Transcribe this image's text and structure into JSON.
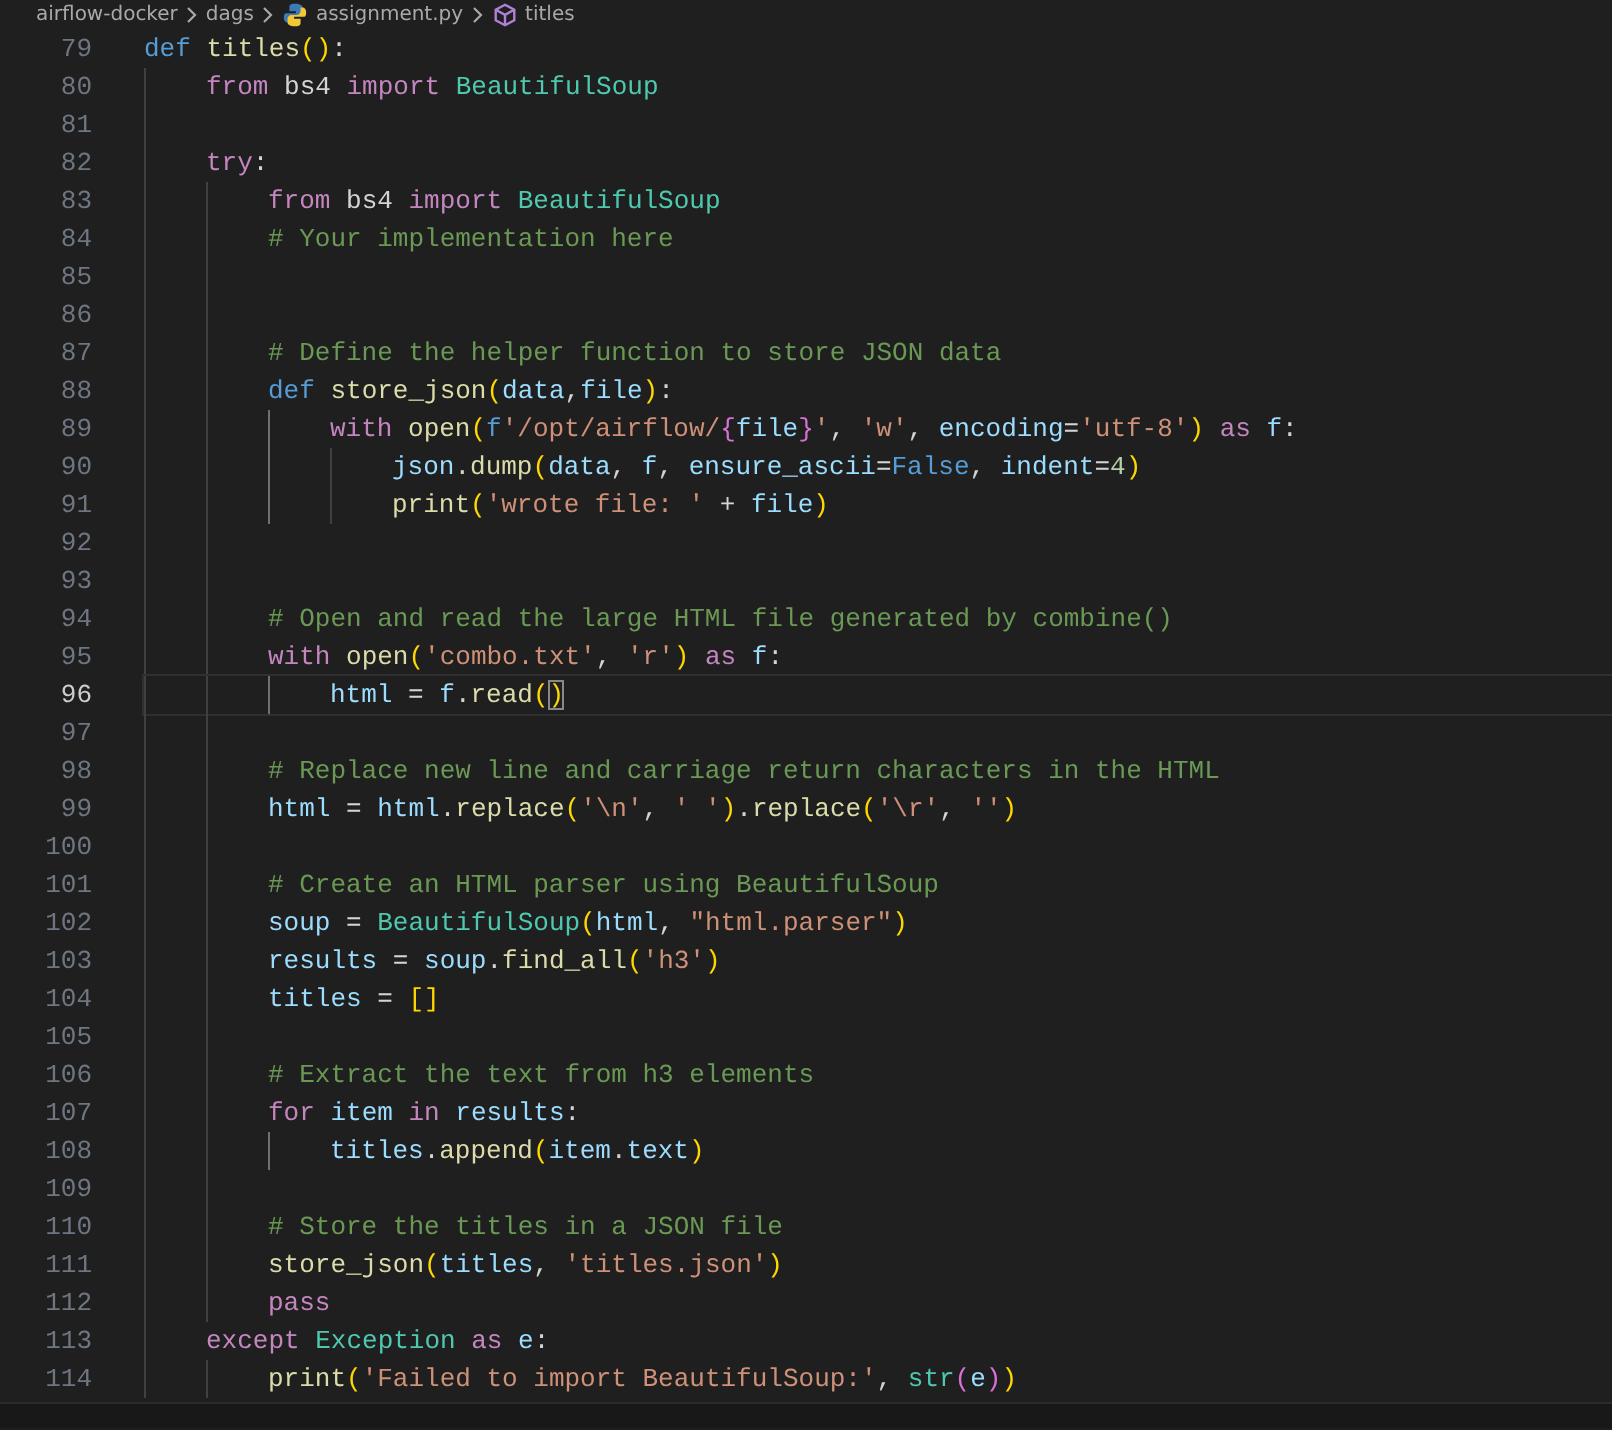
{
  "breadcrumb": [
    {
      "kind": "folder",
      "text": "airflow-docker"
    },
    {
      "kind": "folder",
      "text": "dags"
    },
    {
      "kind": "python-file",
      "text": "assignment.py"
    },
    {
      "kind": "function",
      "text": "titles"
    }
  ],
  "lines": [
    {
      "number": "79",
      "current": false,
      "tokens": [
        {
          "kind": "kw",
          "text": "def "
        },
        {
          "kind": "fn",
          "text": "titles"
        },
        {
          "kind": "b1",
          "text": "()"
        },
        {
          "kind": "op",
          "text": ":"
        }
      ],
      "children": [
        {
          "number": "80",
          "current": false,
          "tokens": [
            {
              "kind": "ctl",
              "text": "from "
            },
            {
              "kind": "mod",
              "text": "bs4 "
            },
            {
              "kind": "ctl",
              "text": "import "
            },
            {
              "kind": "cls",
              "text": "BeautifulSoup"
            }
          ]
        },
        {
          "number": "81",
          "current": false
        },
        {
          "number": "82",
          "current": false,
          "tokens": [
            {
              "kind": "ctl",
              "text": "try"
            },
            {
              "kind": "op",
              "text": ":"
            }
          ],
          "children": [
            {
              "number": "83",
              "current": false,
              "tokens": [
                {
                  "kind": "ctl",
                  "text": "from "
                },
                {
                  "kind": "mod",
                  "text": "bs4 "
                },
                {
                  "kind": "ctl",
                  "text": "import "
                },
                {
                  "kind": "cls",
                  "text": "BeautifulSoup"
                }
              ]
            },
            {
              "number": "84",
              "current": false,
              "tokens": [
                {
                  "kind": "com",
                  "text": "# Your implementation here"
                }
              ]
            },
            {
              "number": "85",
              "current": false
            },
            {
              "number": "86",
              "current": false
            },
            {
              "number": "87",
              "current": false,
              "tokens": [
                {
                  "kind": "com",
                  "text": "# Define the helper function to store JSON data"
                }
              ]
            },
            {
              "number": "88",
              "current": false,
              "tokens": [
                {
                  "kind": "kw",
                  "text": "def "
                },
                {
                  "kind": "fn",
                  "text": "store_json"
                },
                {
                  "kind": "b1",
                  "text": "("
                },
                {
                  "kind": "var",
                  "text": "data"
                },
                {
                  "kind": "op",
                  "text": ","
                },
                {
                  "kind": "var",
                  "text": "file"
                },
                {
                  "kind": "b1",
                  "text": ")"
                },
                {
                  "kind": "op",
                  "text": ":"
                }
              ],
              "children": [
                {
                  "number": "89",
                  "current": false,
                  "tokens": [
                    {
                      "kind": "ctl",
                      "text": "with "
                    },
                    {
                      "kind": "fn",
                      "text": "open"
                    },
                    {
                      "kind": "b1",
                      "text": "("
                    },
                    {
                      "kind": "kw",
                      "text": "f"
                    },
                    {
                      "kind": "str",
                      "text": "'/opt/airflow/"
                    },
                    {
                      "kind": "b2",
                      "text": "{"
                    },
                    {
                      "kind": "var",
                      "text": "file"
                    },
                    {
                      "kind": "b2",
                      "text": "}"
                    },
                    {
                      "kind": "str",
                      "text": "'"
                    },
                    {
                      "kind": "op",
                      "text": ", "
                    },
                    {
                      "kind": "str",
                      "text": "'w'"
                    },
                    {
                      "kind": "op",
                      "text": ", "
                    },
                    {
                      "kind": "var",
                      "text": "encoding"
                    },
                    {
                      "kind": "op",
                      "text": "="
                    },
                    {
                      "kind": "str",
                      "text": "'utf-8'"
                    },
                    {
                      "kind": "b1",
                      "text": ")"
                    },
                    {
                      "kind": "ctl",
                      "text": " as "
                    },
                    {
                      "kind": "var",
                      "text": "f"
                    },
                    {
                      "kind": "op",
                      "text": ":"
                    }
                  ],
                  "children": [
                    {
                      "number": "90",
                      "current": false,
                      "tokens": [
                        {
                          "kind": "var",
                          "text": "json"
                        },
                        {
                          "kind": "op",
                          "text": "."
                        },
                        {
                          "kind": "fn",
                          "text": "dump"
                        },
                        {
                          "kind": "b1",
                          "text": "("
                        },
                        {
                          "kind": "var",
                          "text": "data"
                        },
                        {
                          "kind": "op",
                          "text": ", "
                        },
                        {
                          "kind": "var",
                          "text": "f"
                        },
                        {
                          "kind": "op",
                          "text": ", "
                        },
                        {
                          "kind": "var",
                          "text": "ensure_ascii"
                        },
                        {
                          "kind": "op",
                          "text": "="
                        },
                        {
                          "kind": "kw",
                          "text": "False"
                        },
                        {
                          "kind": "op",
                          "text": ", "
                        },
                        {
                          "kind": "var",
                          "text": "indent"
                        },
                        {
                          "kind": "op",
                          "text": "="
                        },
                        {
                          "kind": "num",
                          "text": "4"
                        },
                        {
                          "kind": "b1",
                          "text": ")"
                        }
                      ]
                    },
                    {
                      "number": "91",
                      "current": false,
                      "tokens": [
                        {
                          "kind": "fn",
                          "text": "print"
                        },
                        {
                          "kind": "b1",
                          "text": "("
                        },
                        {
                          "kind": "str",
                          "text": "'wrote file: '"
                        },
                        {
                          "kind": "op",
                          "text": " + "
                        },
                        {
                          "kind": "var",
                          "text": "file"
                        },
                        {
                          "kind": "b1",
                          "text": ")"
                        }
                      ]
                    }
                  ]
                }
              ]
            },
            {
              "number": "92",
              "current": false
            },
            {
              "number": "93",
              "current": false
            },
            {
              "number": "94",
              "current": false,
              "tokens": [
                {
                  "kind": "com",
                  "text": "# Open and read the large HTML file generated by combine()"
                }
              ]
            },
            {
              "number": "95",
              "current": false,
              "tokens": [
                {
                  "kind": "ctl",
                  "text": "with "
                },
                {
                  "kind": "fn",
                  "text": "open"
                },
                {
                  "kind": "b1",
                  "text": "("
                },
                {
                  "kind": "str",
                  "text": "'combo.txt'"
                },
                {
                  "kind": "op",
                  "text": ", "
                },
                {
                  "kind": "str",
                  "text": "'r'"
                },
                {
                  "kind": "b1",
                  "text": ")"
                },
                {
                  "kind": "ctl",
                  "text": " as "
                },
                {
                  "kind": "var",
                  "text": "f"
                },
                {
                  "kind": "op",
                  "text": ":"
                }
              ],
              "children": [
                {
                  "number": "96",
                  "current": true,
                  "tokens": [
                    {
                      "kind": "var",
                      "text": "html"
                    },
                    {
                      "kind": "op",
                      "text": " = "
                    },
                    {
                      "kind": "var",
                      "text": "f"
                    },
                    {
                      "kind": "op",
                      "text": "."
                    },
                    {
                      "kind": "fn",
                      "text": "read"
                    },
                    {
                      "kind": "b1",
                      "text": "("
                    },
                    {
                      "kind": "match",
                      "text": ")"
                    }
                  ]
                }
              ]
            },
            {
              "number": "97",
              "current": false
            },
            {
              "number": "98",
              "current": false,
              "tokens": [
                {
                  "kind": "com",
                  "text": "# Replace new line and carriage return characters in the HTML"
                }
              ]
            },
            {
              "number": "99",
              "current": false,
              "tokens": [
                {
                  "kind": "var",
                  "text": "html"
                },
                {
                  "kind": "op",
                  "text": " = "
                },
                {
                  "kind": "var",
                  "text": "html"
                },
                {
                  "kind": "op",
                  "text": "."
                },
                {
                  "kind": "fn",
                  "text": "replace"
                },
                {
                  "kind": "b1",
                  "text": "("
                },
                {
                  "kind": "str",
                  "text": "'\\n'"
                },
                {
                  "kind": "op",
                  "text": ", "
                },
                {
                  "kind": "str",
                  "text": "' '"
                },
                {
                  "kind": "b1",
                  "text": ")"
                },
                {
                  "kind": "op",
                  "text": "."
                },
                {
                  "kind": "fn",
                  "text": "replace"
                },
                {
                  "kind": "b1",
                  "text": "("
                },
                {
                  "kind": "str",
                  "text": "'\\r'"
                },
                {
                  "kind": "op",
                  "text": ", "
                },
                {
                  "kind": "str",
                  "text": "''"
                },
                {
                  "kind": "b1",
                  "text": ")"
                }
              ]
            },
            {
              "number": "100",
              "current": false
            },
            {
              "number": "101",
              "current": false,
              "tokens": [
                {
                  "kind": "com",
                  "text": "# Create an HTML parser using BeautifulSoup"
                }
              ]
            },
            {
              "number": "102",
              "current": false,
              "tokens": [
                {
                  "kind": "var",
                  "text": "soup"
                },
                {
                  "kind": "op",
                  "text": " = "
                },
                {
                  "kind": "cls",
                  "text": "BeautifulSoup"
                },
                {
                  "kind": "b1",
                  "text": "("
                },
                {
                  "kind": "var",
                  "text": "html"
                },
                {
                  "kind": "op",
                  "text": ", "
                },
                {
                  "kind": "str",
                  "text": "\"html.parser\""
                },
                {
                  "kind": "b1",
                  "text": ")"
                }
              ]
            },
            {
              "number": "103",
              "current": false,
              "tokens": [
                {
                  "kind": "var",
                  "text": "results"
                },
                {
                  "kind": "op",
                  "text": " = "
                },
                {
                  "kind": "var",
                  "text": "soup"
                },
                {
                  "kind": "op",
                  "text": "."
                },
                {
                  "kind": "fn",
                  "text": "find_all"
                },
                {
                  "kind": "b1",
                  "text": "("
                },
                {
                  "kind": "str",
                  "text": "'h3'"
                },
                {
                  "kind": "b1",
                  "text": ")"
                }
              ]
            },
            {
              "number": "104",
              "current": false,
              "tokens": [
                {
                  "kind": "var",
                  "text": "titles"
                },
                {
                  "kind": "op",
                  "text": " = "
                },
                {
                  "kind": "b1",
                  "text": "[]"
                }
              ]
            },
            {
              "number": "105",
              "current": false
            },
            {
              "number": "106",
              "current": false,
              "tokens": [
                {
                  "kind": "com",
                  "text": "# Extract the text from h3 elements"
                }
              ]
            },
            {
              "number": "107",
              "current": false,
              "tokens": [
                {
                  "kind": "ctl",
                  "text": "for "
                },
                {
                  "kind": "var",
                  "text": "item"
                },
                {
                  "kind": "ctl",
                  "text": " in "
                },
                {
                  "kind": "var",
                  "text": "results"
                },
                {
                  "kind": "op",
                  "text": ":"
                }
              ],
              "children": [
                {
                  "number": "108",
                  "current": false,
                  "tokens": [
                    {
                      "kind": "var",
                      "text": "titles"
                    },
                    {
                      "kind": "op",
                      "text": "."
                    },
                    {
                      "kind": "fn",
                      "text": "append"
                    },
                    {
                      "kind": "b1",
                      "text": "("
                    },
                    {
                      "kind": "var",
                      "text": "item"
                    },
                    {
                      "kind": "op",
                      "text": "."
                    },
                    {
                      "kind": "var",
                      "text": "text"
                    },
                    {
                      "kind": "b1",
                      "text": ")"
                    }
                  ]
                }
              ]
            },
            {
              "number": "109",
              "current": false
            },
            {
              "number": "110",
              "current": false,
              "tokens": [
                {
                  "kind": "com",
                  "text": "# Store the titles in a JSON file"
                }
              ]
            },
            {
              "number": "111",
              "current": false,
              "tokens": [
                {
                  "kind": "fn",
                  "text": "store_json"
                },
                {
                  "kind": "b1",
                  "text": "("
                },
                {
                  "kind": "var",
                  "text": "titles"
                },
                {
                  "kind": "op",
                  "text": ", "
                },
                {
                  "kind": "str",
                  "text": "'titles.json'"
                },
                {
                  "kind": "b1",
                  "text": ")"
                }
              ]
            },
            {
              "number": "112",
              "current": false,
              "tokens": [
                {
                  "kind": "ctl",
                  "text": "pass"
                }
              ]
            }
          ]
        },
        {
          "number": "113",
          "current": false,
          "tokens": [
            {
              "kind": "ctl",
              "text": "except "
            },
            {
              "kind": "cls",
              "text": "Exception"
            },
            {
              "kind": "ctl",
              "text": " as "
            },
            {
              "kind": "var",
              "text": "e"
            },
            {
              "kind": "op",
              "text": ":"
            }
          ],
          "children": [
            {
              "number": "114",
              "current": false,
              "tokens": [
                {
                  "kind": "fn",
                  "text": "print"
                },
                {
                  "kind": "b1",
                  "text": "("
                },
                {
                  "kind": "str",
                  "text": "'Failed to import BeautifulSoup:'"
                },
                {
                  "kind": "op",
                  "text": ", "
                },
                {
                  "kind": "cls",
                  "text": "str"
                },
                {
                  "kind": "b2",
                  "text": "("
                },
                {
                  "kind": "var",
                  "text": "e"
                },
                {
                  "kind": "b2",
                  "text": ")"
                },
                {
                  "kind": "b1",
                  "text": ")"
                }
              ]
            }
          ]
        }
      ]
    }
  ]
}
